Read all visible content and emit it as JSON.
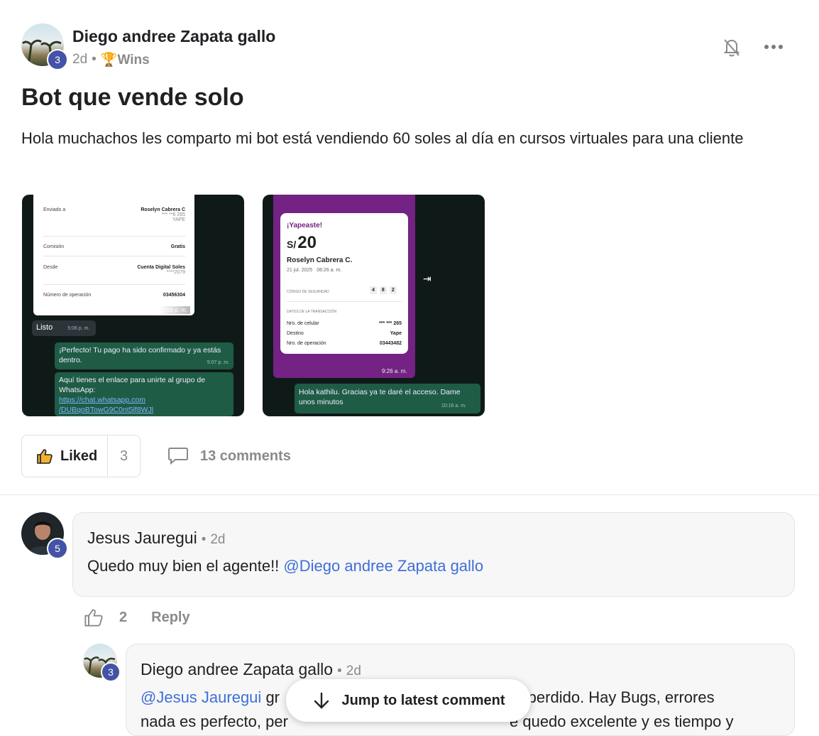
{
  "post": {
    "author": "Diego andree Zapata gallo",
    "author_level": "3",
    "time": "2d",
    "separator": "•",
    "category_icon": "🏆",
    "category": "Wins",
    "title": "Bot que vende solo",
    "body": "Hola muchachos les comparto mi bot está vendiendo 60 soles al día en cursos virtuales para una cliente",
    "liked_label": "Liked",
    "like_count": "3",
    "comments_label": "13 comments"
  },
  "image1": {
    "card_rows": [
      {
        "label": "Enviado a",
        "value": "Roselyn Cabrera C",
        "sub1": "*** **6 265",
        "sub2": "YAPE"
      },
      {
        "label": "Comisión",
        "value": "Gratis"
      },
      {
        "label": "Desde",
        "value": "Cuenta Digital Soles",
        "sub1": "****2079"
      },
      {
        "label": "Número de operación",
        "value": "03456304"
      }
    ],
    "card_time": "5:06 p. m.",
    "listo": "Listo",
    "listo_time": "5:06 p. m.",
    "msg1": "¡Perfecto! Tu pago ha sido confirmado y ya estás dentro.",
    "msg1_time": "5:07 p. m.",
    "msg2_line1": "Aquí tienes el enlace para unirte al grupo de WhatsApp:",
    "msg2_link1": "https://chat.whatsapp.com",
    "msg2_link2": "/DUBqoBTowG9C0nt5lf8WJl"
  },
  "image2": {
    "yapeaste": "¡Yapeaste!",
    "currency": "S/",
    "amount": "20",
    "name": "Roselyn Cabrera C.",
    "date": "21 jul. 2025",
    "time": "08:26 a. m.",
    "security_label": "CÓDIGO DE SEGURIDAD",
    "security_digits": [
      "4",
      "8",
      "2"
    ],
    "tx_label": "DATOS DE LA TRANSACCIÓN",
    "rows": [
      {
        "label": "Nro. de celular",
        "value": "*** *** 265"
      },
      {
        "label": "Destino",
        "value": "Yape"
      },
      {
        "label": "Nro. de operación",
        "value": "03443482"
      }
    ],
    "image_time": "9:26 a. m.",
    "reply": "Hola kathilu. Gracias ya te daré el acceso. Dame unos minutos",
    "reply_time": "10:16 a. m."
  },
  "comment1": {
    "author": "Jesus Jauregui",
    "author_level": "5",
    "time": "2d",
    "separator": "•",
    "text": "Quedo muy bien el agente!!",
    "mention": "@Diego andree Zapata gallo",
    "like_count": "2",
    "reply_label": "Reply"
  },
  "comment2": {
    "author": "Diego andree Zapata gallo",
    "author_level": "3",
    "time": "2d",
    "separator": "•",
    "mention": "@Jesus Jauregui",
    "text_start": "gr",
    "text_end": "ra perdido. Hay Bugs, errores",
    "line2_start": "nada es perfecto, per",
    "line2_end": "e quedo excelente y es tiempo y"
  },
  "jump_button": "Jump to latest comment",
  "colors": {
    "accent": "#4453a6",
    "mention": "#3f6fd8",
    "yape_purple": "#742284",
    "wa_green": "#1f5c45"
  }
}
